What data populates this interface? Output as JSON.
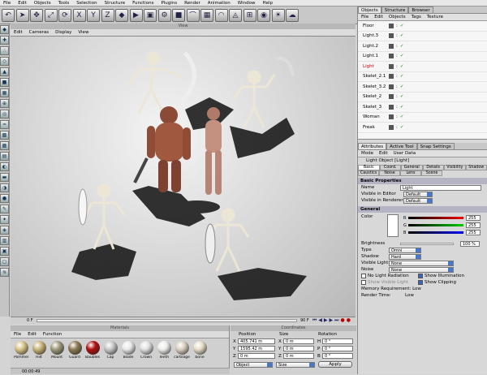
{
  "menubar": {
    "items": [
      "File",
      "Edit",
      "Objects",
      "Tools",
      "Selection",
      "Structure",
      "Functions",
      "Plugins",
      "Render",
      "Animation",
      "Window",
      "Help"
    ]
  },
  "toolbar": {
    "icons": [
      "undo-icon",
      "arrow-select-icon",
      "move-icon",
      "scale-icon",
      "rotate-icon",
      "x-axis-icon",
      "y-axis-icon",
      "z-axis-icon",
      "object-mode-icon",
      "render-active-view-icon",
      "render-view-icon",
      "render-settings-icon",
      "cube-icon",
      "bend-icon",
      "array-icon",
      "nurbs-icon",
      "deformer-icon",
      "scene-icon",
      "camera-icon",
      "light-icon",
      "sky-icon"
    ]
  },
  "viewport": {
    "title": "View",
    "menu": [
      "Edit",
      "Cameras",
      "Display",
      "View"
    ]
  },
  "timeline": {
    "start": "0 F",
    "end": "90 F"
  },
  "materials": {
    "title": "Materials",
    "menu": [
      "File",
      "Edit",
      "Function"
    ],
    "items": [
      {
        "name": "Pommel",
        "color": "#d9c58a"
      },
      {
        "name": "Hilt",
        "color": "#c7b47a"
      },
      {
        "name": "Mount",
        "color": "#a0997a"
      },
      {
        "name": "Guard",
        "color": "#8c7a55"
      },
      {
        "name": "Baubles",
        "color": "#b01010"
      },
      {
        "name": "Cap",
        "color": "#c8c8c8"
      },
      {
        "name": "Blade",
        "color": "#e8e8e8"
      },
      {
        "name": "Crown",
        "color": "#e0e0e0"
      },
      {
        "name": "Teeth",
        "color": "#eeeeea"
      },
      {
        "name": "cartilage",
        "color": "#d8d0c0"
      },
      {
        "name": "bone",
        "color": "#e6ddc8"
      }
    ]
  },
  "coordinates": {
    "title": "Coordinates",
    "headers": [
      "Position",
      "Size",
      "Rotation"
    ],
    "rows": [
      {
        "axis": "X",
        "pos": "405.741 m",
        "size": "0 m",
        "rot_axis": "H",
        "rot": "0 °"
      },
      {
        "axis": "Y",
        "pos": "1595.42 m",
        "size": "0 m",
        "rot_axis": "P",
        "rot": "0 °"
      },
      {
        "axis": "Z",
        "pos": "0 m",
        "size": "0 m",
        "rot_axis": "B",
        "rot": "0 °"
      }
    ],
    "mode_left": "Object",
    "mode_mid": "Size",
    "apply": "Apply"
  },
  "status": {
    "time": "00:00:49"
  },
  "objects": {
    "tabs": [
      "Objects",
      "Structure",
      "Browser"
    ],
    "menu": [
      "File",
      "Edit",
      "Objects",
      "Tags",
      "Texture"
    ],
    "rows": [
      "Floor",
      "Light.3",
      "Light.2",
      "Light.1",
      "Light",
      "Skelet_2.1",
      "Skelet_3.2",
      "Skelet_2",
      "Skelet_3",
      "Woman",
      "Freak"
    ]
  },
  "attributes": {
    "tabs": [
      "Attributes",
      "Active Tool",
      "Snap Settings"
    ],
    "menu": [
      "Mode",
      "Edit",
      "User Data"
    ],
    "title": "Light Object [Light]",
    "subtabs_row1": [
      "Basic",
      "Coord.",
      "General",
      "Details",
      "Visibility",
      "Shadow"
    ],
    "subtabs_row2": [
      "Caustics",
      "Noise",
      "Lens",
      "Scene"
    ],
    "basic_header": "Basic Properties",
    "name_label": "Name",
    "name_value": "Light",
    "vis_editor_label": "Visible in Editor",
    "vis_editor_value": "Default",
    "vis_render_label": "Visible in Renderer",
    "vis_render_value": "Default",
    "general_header": "General",
    "color_label": "Color",
    "r_label": "R",
    "r_value": "255",
    "g_label": "G",
    "g_value": "255",
    "b_label": "B",
    "b_value": "255",
    "brightness_label": "Brightness",
    "brightness_value": "100 %",
    "type_label": "Type",
    "type_value": "Omni",
    "shadow_label": "Shadow",
    "shadow_value": "Hard",
    "vislight_label": "Visible Light",
    "vislight_value": "None",
    "noise_label": "Noise",
    "noise_value": "None",
    "no_light_radiation": "No Light Radiation",
    "show_illumination": "Show Illumination",
    "show_visible_light": "Show Visible Light",
    "show_clipping": "Show Clipping",
    "memory_label": "Memory Requirement: Low",
    "render_time_label": "Render Time:",
    "render_time_value": "Low"
  }
}
